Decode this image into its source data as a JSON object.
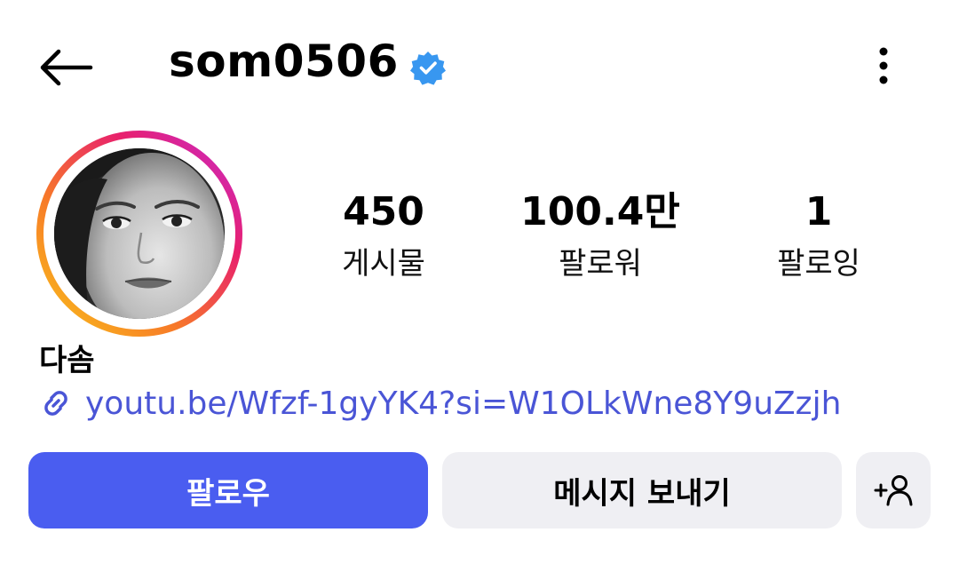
{
  "header": {
    "username": "som0506",
    "verified_icon": "verified-badge-icon",
    "verified_color": "#3897f0",
    "back_icon": "arrow-left-icon",
    "more_icon": "more-vertical-icon"
  },
  "profile": {
    "avatar_ring_colors": [
      "#f9c31a",
      "#f77a28",
      "#e8206d",
      "#c52bd2"
    ],
    "display_name": "다솜",
    "link": {
      "icon": "link-icon",
      "text": "youtu.be/Wfzf-1gyYK4?si=W1OLkWne8Y9uZzjh",
      "color": "#4a55d6"
    }
  },
  "stats": [
    {
      "value": "450",
      "label": "게시물"
    },
    {
      "value": "100.4만",
      "label": "팔로워"
    },
    {
      "value": "1",
      "label": "팔로잉"
    }
  ],
  "actions": {
    "follow_label": "팔로우",
    "follow_color": "#4a5df0",
    "message_label": "메시지 보내기",
    "suggest_icon": "add-person-icon"
  }
}
